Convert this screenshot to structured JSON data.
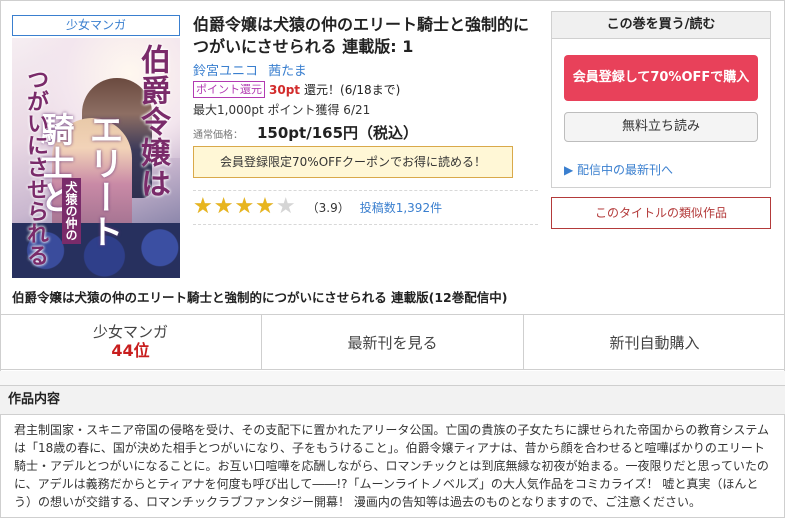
{
  "genre_tag": "少女マンガ",
  "title": "伯爵令嬢は犬猿の仲のエリート騎士と強制的につがいにさせられる 連載版: 1",
  "authors": [
    "鈴宮ユニコ",
    "茜たま"
  ],
  "points": {
    "badge": "ポイント還元",
    "amount": "30pt",
    "suffix": "還元！(6/18まで)"
  },
  "max_points": "最大1,000pt ポイント獲得 6/21",
  "price": {
    "label": "通常価格：",
    "value": "150pt/165円（税込）"
  },
  "coupon": "会員登録限定70%OFFクーポンでお得に読める！",
  "rating": {
    "stars": "★★★★★",
    "value": 3.9,
    "score_text": "（3.9）",
    "reviews": "投稿数1,392件"
  },
  "buybox": {
    "header": "この巻を買う/読む",
    "register_button": "会員登録して70%OFFで購入",
    "free_button": "無料立ち読み",
    "latest_link": "▶ 配信中の最新刊へ"
  },
  "similar_button": "このタイトルの類似作品",
  "cover": {
    "title_line1": "伯爵令嬢は",
    "title_line2": "エリート騎士と",
    "title_line3": "つがいにさせられる",
    "subtitle": "犬猿の仲の"
  },
  "full_title": "伯爵令嬢は犬猿の仲のエリート騎士と強制的につがいにさせられる 連載版(12巻配信中)",
  "strip": {
    "rank_label": "少女マンガ",
    "rank": "44位",
    "latest": "最新刊を見る",
    "auto_buy": "新刊自動購入"
  },
  "description": {
    "header": "作品内容",
    "text": "君主制国家・スキニア帝国の侵略を受け、その支配下に置かれたアリータ公国。亡国の貴族の子女たちに課せられた帝国からの教育システムは「18歳の春に、国が決めた相手とつがいになり、子をもうけること」。伯爵令嬢ティアナは、昔から顔を合わせると喧嘩ばかりのエリート騎士・アデルとつがいになることに。お互い口喧嘩を応酬しながら、ロマンチックとは到底無縁な初夜が始まる。一夜限りだと思っていたのに、アデルは義務だからとティアナを何度も呼び出して――!?「ムーンライトノベルズ」の大人気作品をコミカライズ！ 嘘と真実（ほんとう）の想いが交錯する、ロマンチックラブファンタジー開幕！ 漫画内の告知等は過去のものとなりますので、ご注意ください。"
  }
}
